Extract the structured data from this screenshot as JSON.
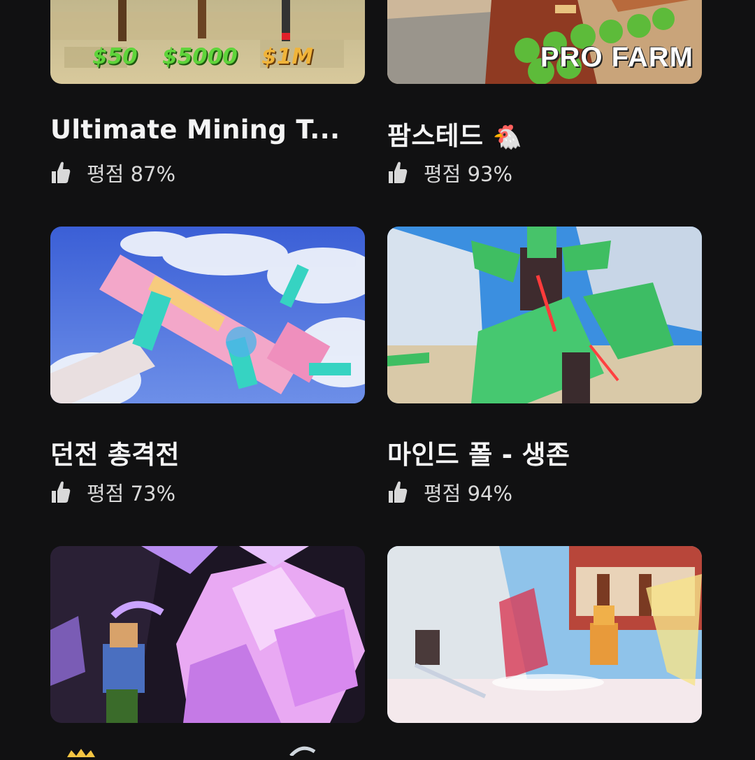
{
  "games": [
    {
      "title": "Ultimate Mining T...",
      "rating_label": "평점 87%",
      "thumb_prices": [
        "$50",
        "$5000",
        "$1M"
      ]
    },
    {
      "title": "팜스테드",
      "title_emoji": "🐔",
      "rating_label": "평점 93%",
      "thumb_text": "PRO FARM"
    },
    {
      "title": "던전 총격전",
      "rating_label": "평점 73%"
    },
    {
      "title": "마인드 폴 - 생존",
      "rating_label": "평점 94%"
    },
    {
      "title": "",
      "rating_label": ""
    },
    {
      "title": "",
      "rating_label": ""
    }
  ],
  "icons": {
    "rating": "thumbs-up-icon"
  }
}
